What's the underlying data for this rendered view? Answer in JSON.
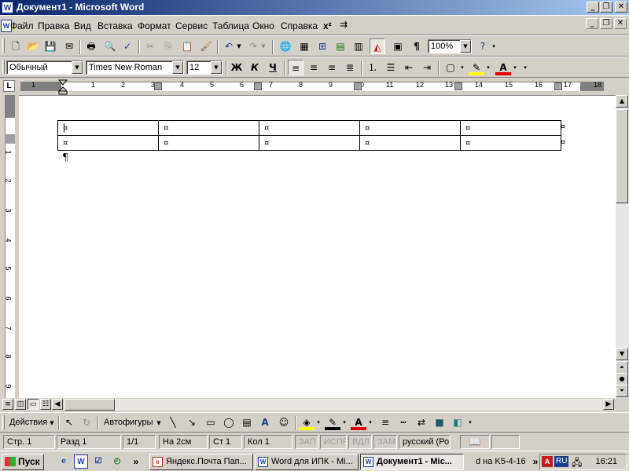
{
  "window": {
    "title": "Документ1 - Microsoft Word",
    "app_icon": "W"
  },
  "menu": [
    "Файл",
    "Правка",
    "Вид",
    "Вставка",
    "Формат",
    "Сервис",
    "Таблица",
    "Окно",
    "Справка"
  ],
  "menu_extra": "x²",
  "standard_toolbar": {
    "zoom": "100%"
  },
  "formatting_toolbar": {
    "style": "Обычный",
    "font": "Times New Roman",
    "size": "12",
    "bold": "Ж",
    "italic": "К",
    "underline": "Ч"
  },
  "ruler": {
    "h_numbers": [
      "1",
      "1",
      "2",
      "3",
      "4",
      "5",
      "6",
      "7",
      "8",
      "9",
      "10",
      "11",
      "12",
      "13",
      "14",
      "15",
      "16",
      "17",
      "18"
    ],
    "v_numbers": [
      "1",
      "2",
      "3",
      "4",
      "5",
      "6",
      "7",
      "8",
      "9"
    ]
  },
  "document": {
    "rows": [
      [
        "¤",
        "¤",
        "¤",
        "¤",
        "¤"
      ],
      [
        "¤",
        "¤",
        "¤",
        "¤",
        "¤"
      ]
    ],
    "row_end_marks": [
      "¤",
      "¤"
    ],
    "paragraph_mark": "¶"
  },
  "drawing_toolbar": {
    "actions": "Действия",
    "autoshapes": "Автофигуры"
  },
  "status": {
    "page": "Стр. 1",
    "section": "Разд 1",
    "pages": "1/1",
    "at": "На  2см",
    "line": "Ст  1",
    "col": "Кол  1",
    "rec": "ЗАП",
    "trk": "ИСПР",
    "ext": "ВДЛ",
    "ovr": "ЗАМ",
    "lang": "русский (Ро"
  },
  "taskbar": {
    "start": "Пуск",
    "tasks": [
      "Яндекс.Почта Пап...",
      "Word для  ИПК - Mi...",
      "Документ1 - Mic..."
    ],
    "extra": "d на K5-4-16",
    "lang": "RU",
    "time": "16:21"
  }
}
